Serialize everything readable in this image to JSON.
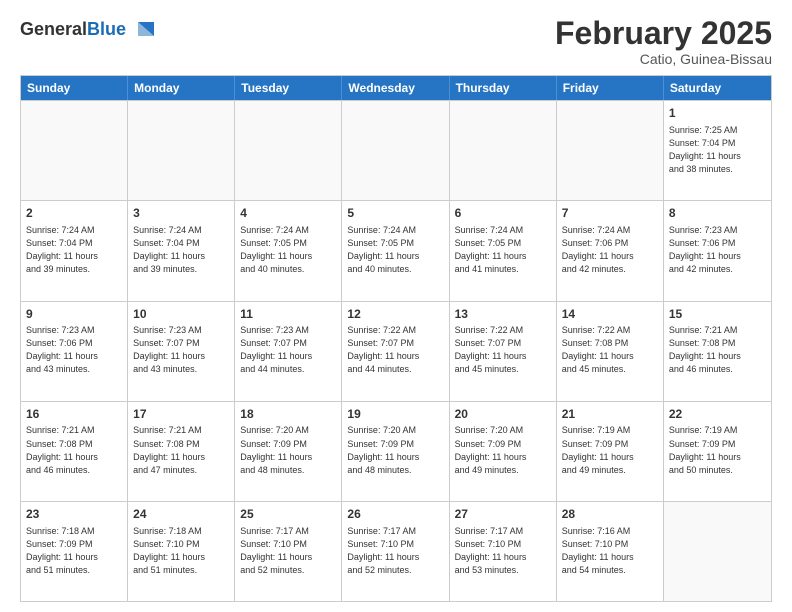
{
  "logo": {
    "general": "General",
    "blue": "Blue"
  },
  "title": {
    "month_year": "February 2025",
    "location": "Catio, Guinea-Bissau"
  },
  "header": {
    "days": [
      "Sunday",
      "Monday",
      "Tuesday",
      "Wednesday",
      "Thursday",
      "Friday",
      "Saturday"
    ]
  },
  "weeks": [
    [
      {
        "day": "",
        "info": ""
      },
      {
        "day": "",
        "info": ""
      },
      {
        "day": "",
        "info": ""
      },
      {
        "day": "",
        "info": ""
      },
      {
        "day": "",
        "info": ""
      },
      {
        "day": "",
        "info": ""
      },
      {
        "day": "1",
        "info": "Sunrise: 7:25 AM\nSunset: 7:04 PM\nDaylight: 11 hours\nand 38 minutes."
      }
    ],
    [
      {
        "day": "2",
        "info": "Sunrise: 7:24 AM\nSunset: 7:04 PM\nDaylight: 11 hours\nand 39 minutes."
      },
      {
        "day": "3",
        "info": "Sunrise: 7:24 AM\nSunset: 7:04 PM\nDaylight: 11 hours\nand 39 minutes."
      },
      {
        "day": "4",
        "info": "Sunrise: 7:24 AM\nSunset: 7:05 PM\nDaylight: 11 hours\nand 40 minutes."
      },
      {
        "day": "5",
        "info": "Sunrise: 7:24 AM\nSunset: 7:05 PM\nDaylight: 11 hours\nand 40 minutes."
      },
      {
        "day": "6",
        "info": "Sunrise: 7:24 AM\nSunset: 7:05 PM\nDaylight: 11 hours\nand 41 minutes."
      },
      {
        "day": "7",
        "info": "Sunrise: 7:24 AM\nSunset: 7:06 PM\nDaylight: 11 hours\nand 42 minutes."
      },
      {
        "day": "8",
        "info": "Sunrise: 7:23 AM\nSunset: 7:06 PM\nDaylight: 11 hours\nand 42 minutes."
      }
    ],
    [
      {
        "day": "9",
        "info": "Sunrise: 7:23 AM\nSunset: 7:06 PM\nDaylight: 11 hours\nand 43 minutes."
      },
      {
        "day": "10",
        "info": "Sunrise: 7:23 AM\nSunset: 7:07 PM\nDaylight: 11 hours\nand 43 minutes."
      },
      {
        "day": "11",
        "info": "Sunrise: 7:23 AM\nSunset: 7:07 PM\nDaylight: 11 hours\nand 44 minutes."
      },
      {
        "day": "12",
        "info": "Sunrise: 7:22 AM\nSunset: 7:07 PM\nDaylight: 11 hours\nand 44 minutes."
      },
      {
        "day": "13",
        "info": "Sunrise: 7:22 AM\nSunset: 7:07 PM\nDaylight: 11 hours\nand 45 minutes."
      },
      {
        "day": "14",
        "info": "Sunrise: 7:22 AM\nSunset: 7:08 PM\nDaylight: 11 hours\nand 45 minutes."
      },
      {
        "day": "15",
        "info": "Sunrise: 7:21 AM\nSunset: 7:08 PM\nDaylight: 11 hours\nand 46 minutes."
      }
    ],
    [
      {
        "day": "16",
        "info": "Sunrise: 7:21 AM\nSunset: 7:08 PM\nDaylight: 11 hours\nand 46 minutes."
      },
      {
        "day": "17",
        "info": "Sunrise: 7:21 AM\nSunset: 7:08 PM\nDaylight: 11 hours\nand 47 minutes."
      },
      {
        "day": "18",
        "info": "Sunrise: 7:20 AM\nSunset: 7:09 PM\nDaylight: 11 hours\nand 48 minutes."
      },
      {
        "day": "19",
        "info": "Sunrise: 7:20 AM\nSunset: 7:09 PM\nDaylight: 11 hours\nand 48 minutes."
      },
      {
        "day": "20",
        "info": "Sunrise: 7:20 AM\nSunset: 7:09 PM\nDaylight: 11 hours\nand 49 minutes."
      },
      {
        "day": "21",
        "info": "Sunrise: 7:19 AM\nSunset: 7:09 PM\nDaylight: 11 hours\nand 49 minutes."
      },
      {
        "day": "22",
        "info": "Sunrise: 7:19 AM\nSunset: 7:09 PM\nDaylight: 11 hours\nand 50 minutes."
      }
    ],
    [
      {
        "day": "23",
        "info": "Sunrise: 7:18 AM\nSunset: 7:09 PM\nDaylight: 11 hours\nand 51 minutes."
      },
      {
        "day": "24",
        "info": "Sunrise: 7:18 AM\nSunset: 7:10 PM\nDaylight: 11 hours\nand 51 minutes."
      },
      {
        "day": "25",
        "info": "Sunrise: 7:17 AM\nSunset: 7:10 PM\nDaylight: 11 hours\nand 52 minutes."
      },
      {
        "day": "26",
        "info": "Sunrise: 7:17 AM\nSunset: 7:10 PM\nDaylight: 11 hours\nand 52 minutes."
      },
      {
        "day": "27",
        "info": "Sunrise: 7:17 AM\nSunset: 7:10 PM\nDaylight: 11 hours\nand 53 minutes."
      },
      {
        "day": "28",
        "info": "Sunrise: 7:16 AM\nSunset: 7:10 PM\nDaylight: 11 hours\nand 54 minutes."
      },
      {
        "day": "",
        "info": ""
      }
    ]
  ]
}
